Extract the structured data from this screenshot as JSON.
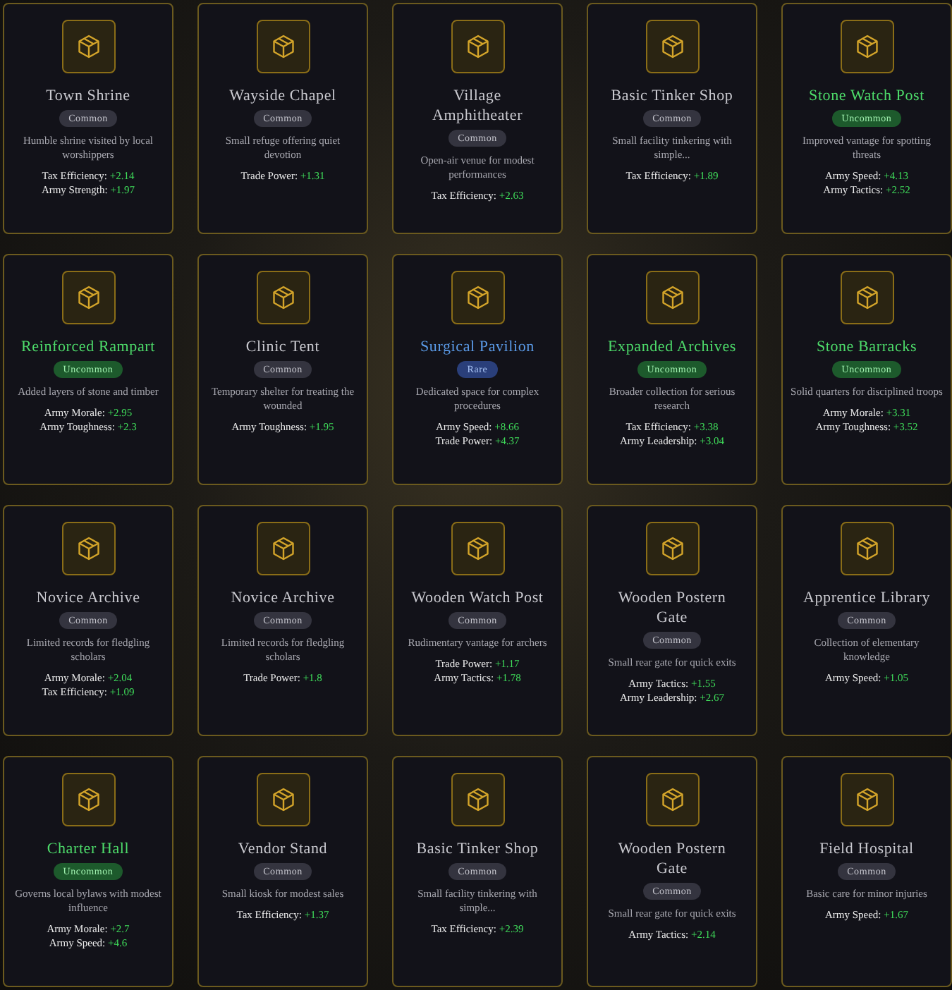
{
  "cards": [
    {
      "name": "Town Shrine",
      "rarity": "Common",
      "kind": "common",
      "description": "Humble shrine visited by local worshippers",
      "stats": [
        {
          "label": "Tax Efficiency:",
          "value": "+2.14"
        },
        {
          "label": "Army Strength:",
          "value": "+1.97"
        }
      ]
    },
    {
      "name": "Wayside Chapel",
      "rarity": "Common",
      "kind": "common",
      "description": "Small refuge offering quiet devotion",
      "stats": [
        {
          "label": "Trade Power:",
          "value": "+1.31"
        }
      ]
    },
    {
      "name": "Village Amphitheater",
      "rarity": "Common",
      "kind": "common",
      "description": "Open-air venue for modest performances",
      "stats": [
        {
          "label": "Tax Efficiency:",
          "value": "+2.63"
        }
      ]
    },
    {
      "name": "Basic Tinker Shop",
      "rarity": "Common",
      "kind": "common",
      "description": "Small facility tinkering with simple...",
      "stats": [
        {
          "label": "Tax Efficiency:",
          "value": "+1.89"
        }
      ]
    },
    {
      "name": "Stone Watch Post",
      "rarity": "Uncommon",
      "kind": "uncommon",
      "description": "Improved vantage for spotting threats",
      "stats": [
        {
          "label": "Army Speed:",
          "value": "+4.13"
        },
        {
          "label": "Army Tactics:",
          "value": "+2.52"
        }
      ]
    },
    {
      "name": "Reinforced Rampart",
      "rarity": "Uncommon",
      "kind": "uncommon",
      "description": "Added layers of stone and timber",
      "stats": [
        {
          "label": "Army Morale:",
          "value": "+2.95"
        },
        {
          "label": "Army Toughness:",
          "value": "+2.3"
        }
      ]
    },
    {
      "name": "Clinic Tent",
      "rarity": "Common",
      "kind": "common",
      "description": "Temporary shelter for treating the wounded",
      "stats": [
        {
          "label": "Army Toughness:",
          "value": "+1.95"
        }
      ]
    },
    {
      "name": "Surgical Pavilion",
      "rarity": "Rare",
      "kind": "rare",
      "description": "Dedicated space for complex procedures",
      "stats": [
        {
          "label": "Army Speed:",
          "value": "+8.66"
        },
        {
          "label": "Trade Power:",
          "value": "+4.37"
        }
      ]
    },
    {
      "name": "Expanded Archives",
      "rarity": "Uncommon",
      "kind": "uncommon",
      "description": "Broader collection for serious research",
      "stats": [
        {
          "label": "Tax Efficiency:",
          "value": "+3.38"
        },
        {
          "label": "Army Leadership:",
          "value": "+3.04"
        }
      ]
    },
    {
      "name": "Stone Barracks",
      "rarity": "Uncommon",
      "kind": "uncommon",
      "description": "Solid quarters for disciplined troops",
      "stats": [
        {
          "label": "Army Morale:",
          "value": "+3.31"
        },
        {
          "label": "Army Toughness:",
          "value": "+3.52"
        }
      ]
    },
    {
      "name": "Novice Archive",
      "rarity": "Common",
      "kind": "common",
      "description": "Limited records for fledgling scholars",
      "stats": [
        {
          "label": "Army Morale:",
          "value": "+2.04"
        },
        {
          "label": "Tax Efficiency:",
          "value": "+1.09"
        }
      ]
    },
    {
      "name": "Novice Archive",
      "rarity": "Common",
      "kind": "common",
      "description": "Limited records for fledgling scholars",
      "stats": [
        {
          "label": "Trade Power:",
          "value": "+1.8"
        }
      ]
    },
    {
      "name": "Wooden Watch Post",
      "rarity": "Common",
      "kind": "common",
      "description": "Rudimentary vantage for archers",
      "stats": [
        {
          "label": "Trade Power:",
          "value": "+1.17"
        },
        {
          "label": "Army Tactics:",
          "value": "+1.78"
        }
      ]
    },
    {
      "name": "Wooden Postern Gate",
      "rarity": "Common",
      "kind": "common",
      "description": "Small rear gate for quick exits",
      "stats": [
        {
          "label": "Army Tactics:",
          "value": "+1.55"
        },
        {
          "label": "Army Leadership:",
          "value": "+2.67"
        }
      ]
    },
    {
      "name": "Apprentice Library",
      "rarity": "Common",
      "kind": "common",
      "description": "Collection of elementary knowledge",
      "stats": [
        {
          "label": "Army Speed:",
          "value": "+1.05"
        }
      ]
    },
    {
      "name": "Charter Hall",
      "rarity": "Uncommon",
      "kind": "uncommon",
      "description": "Governs local bylaws with modest influence",
      "stats": [
        {
          "label": "Army Morale:",
          "value": "+2.7"
        },
        {
          "label": "Army Speed:",
          "value": "+4.6"
        }
      ]
    },
    {
      "name": "Vendor Stand",
      "rarity": "Common",
      "kind": "common",
      "description": "Small kiosk for modest sales",
      "stats": [
        {
          "label": "Tax Efficiency:",
          "value": "+1.37"
        }
      ]
    },
    {
      "name": "Basic Tinker Shop",
      "rarity": "Common",
      "kind": "common",
      "description": "Small facility tinkering with simple...",
      "stats": [
        {
          "label": "Tax Efficiency:",
          "value": "+2.39"
        }
      ]
    },
    {
      "name": "Wooden Postern Gate",
      "rarity": "Common",
      "kind": "common",
      "description": "Small rear gate for quick exits",
      "stats": [
        {
          "label": "Army Tactics:",
          "value": "+2.14"
        }
      ]
    },
    {
      "name": "Field Hospital",
      "rarity": "Common",
      "kind": "common",
      "description": "Basic care for minor injuries",
      "stats": [
        {
          "label": "Army Speed:",
          "value": "+1.67"
        }
      ]
    }
  ]
}
